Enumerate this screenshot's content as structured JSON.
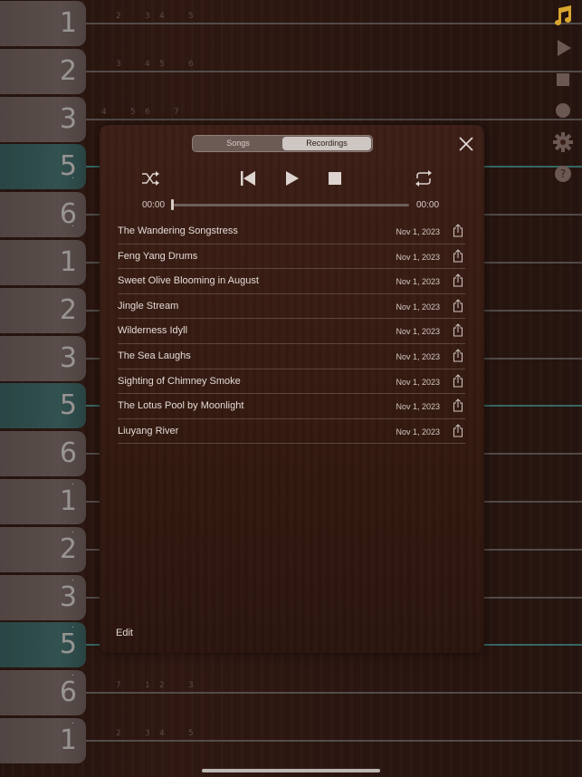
{
  "keys": [
    {
      "label": "1",
      "accent": false,
      "top_dot": false,
      "bottom_dot": false
    },
    {
      "label": "2",
      "accent": false,
      "top_dot": false,
      "bottom_dot": false
    },
    {
      "label": "3",
      "accent": false,
      "top_dot": false,
      "bottom_dot": false
    },
    {
      "label": "5",
      "accent": true,
      "top_dot": false,
      "bottom_dot": true
    },
    {
      "label": "6",
      "accent": false,
      "top_dot": false,
      "bottom_dot": true
    },
    {
      "label": "1",
      "accent": false,
      "top_dot": false,
      "bottom_dot": false
    },
    {
      "label": "2",
      "accent": false,
      "top_dot": false,
      "bottom_dot": false
    },
    {
      "label": "3",
      "accent": false,
      "top_dot": false,
      "bottom_dot": false
    },
    {
      "label": "5",
      "accent": true,
      "top_dot": false,
      "bottom_dot": false
    },
    {
      "label": "6",
      "accent": false,
      "top_dot": false,
      "bottom_dot": false
    },
    {
      "label": "1",
      "accent": false,
      "top_dot": true,
      "bottom_dot": false
    },
    {
      "label": "2",
      "accent": false,
      "top_dot": true,
      "bottom_dot": false
    },
    {
      "label": "3",
      "accent": false,
      "top_dot": true,
      "bottom_dot": false
    },
    {
      "label": "5",
      "accent": true,
      "top_dot": true,
      "bottom_dot": false
    },
    {
      "label": "6",
      "accent": false,
      "top_dot": true,
      "bottom_dot": false
    },
    {
      "label": "1",
      "accent": false,
      "top_dot": true,
      "bottom_dot": false
    }
  ],
  "fret_rows": [
    {
      "row": 0,
      "marks": [
        "2",
        "3",
        "4",
        "5"
      ]
    },
    {
      "row": 1,
      "marks": [
        "3",
        "4",
        "5",
        "6"
      ]
    },
    {
      "row": 2,
      "marks": [
        "4",
        "5",
        "6",
        "7"
      ]
    },
    {
      "row": 14,
      "marks": [
        "7",
        "1",
        "2",
        "3"
      ]
    },
    {
      "row": 15,
      "marks": [
        "2",
        "3",
        "4",
        "5"
      ]
    }
  ],
  "toolbar": [
    "music-note-icon",
    "play-icon",
    "stop-icon",
    "record-icon",
    "settings-icon",
    "help-icon"
  ],
  "colors": {
    "accent": "#55a7a0",
    "wood": "#4a261b",
    "toolbar_active": "#d9a62e",
    "toolbar_inactive": "#6b5853"
  },
  "panel": {
    "tabs": [
      {
        "label": "Songs",
        "active": false
      },
      {
        "label": "Recordings",
        "active": true
      }
    ],
    "time_elapsed": "00:00",
    "time_total": "00:00",
    "progress": 0,
    "recordings": [
      {
        "title": "The Wandering Songstress",
        "date": "Nov 1, 2023"
      },
      {
        "title": "Feng Yang Drums",
        "date": "Nov 1, 2023"
      },
      {
        "title": "Sweet Olive Blooming in August",
        "date": "Nov 1, 2023"
      },
      {
        "title": "Jingle Stream",
        "date": "Nov 1, 2023"
      },
      {
        "title": "Wilderness  Idyll",
        "date": "Nov 1, 2023"
      },
      {
        "title": "The Sea Laughs",
        "date": "Nov 1, 2023"
      },
      {
        "title": "Sighting of Chimney Smoke",
        "date": "Nov 1, 2023"
      },
      {
        "title": "The Lotus Pool by Moonlight",
        "date": "Nov 1, 2023"
      },
      {
        "title": "Liuyang River",
        "date": "Nov 1, 2023"
      }
    ],
    "edit_label": "Edit"
  }
}
